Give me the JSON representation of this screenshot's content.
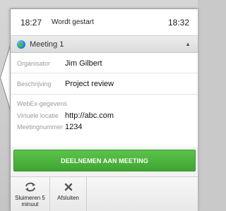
{
  "status_bar": {
    "time_left": "18:27",
    "message": "Wordt gestart",
    "time_right": "18:32"
  },
  "meeting": {
    "title": "Meeting 1",
    "icon": "globe-icon",
    "collapse_icon": "triangle-up-icon"
  },
  "details": {
    "organizer_label": "Organisator",
    "organizer_value": "Jim Gilbert",
    "description_label": "Beschrijving",
    "description_value": "Project review",
    "webex_label": "WebEx-gegevens",
    "location_label": "Virtuele locatie",
    "location_value": "http://abc.com",
    "number_label": "Meetingnummer",
    "number_value": "1234"
  },
  "join_button": {
    "label": "DEELNEMEN AAN MEETING",
    "color": "#4cb43e"
  },
  "actions": {
    "snooze_label": "Sluimeren 5 minuut",
    "snooze_icon": "refresh-icon",
    "close_label": "Afsluiten",
    "close_icon": "close-icon"
  }
}
